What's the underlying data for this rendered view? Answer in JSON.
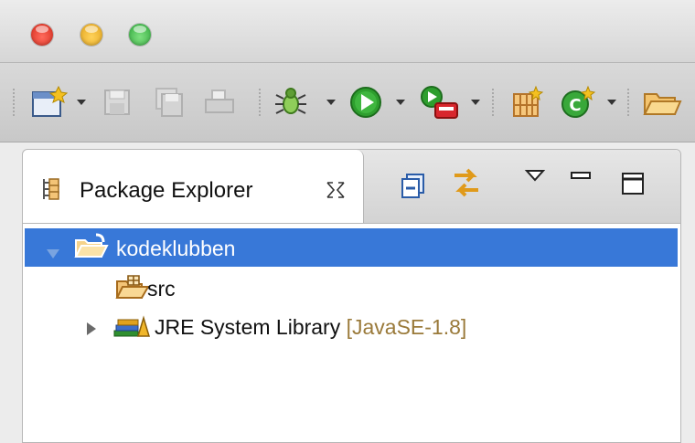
{
  "window": {
    "controls": [
      "close",
      "minimize",
      "zoom"
    ]
  },
  "toolbar": {
    "icons": [
      "new-icon",
      "save-icon",
      "save-all-icon",
      "print-icon",
      "debug-icon",
      "run-icon",
      "external-tools-icon",
      "new-java-package-icon",
      "new-java-class-icon",
      "open-icon"
    ]
  },
  "view": {
    "title": "Package Explorer",
    "close_glyph": "✕",
    "actions": [
      "collapse-all-icon",
      "link-with-editor-icon",
      "view-menu-icon",
      "minimize-icon",
      "maximize-icon"
    ]
  },
  "tree": {
    "project": {
      "name": "kodeklubben",
      "selected": true,
      "expanded": true
    },
    "items": [
      {
        "name": "src",
        "type": "source-folder"
      },
      {
        "name": "JRE System Library",
        "decoration": "[JavaSE-1.8]",
        "type": "library",
        "expanded": false
      }
    ]
  },
  "colors": {
    "selection": "#3878d8",
    "decoration": "#9a7a3a"
  }
}
